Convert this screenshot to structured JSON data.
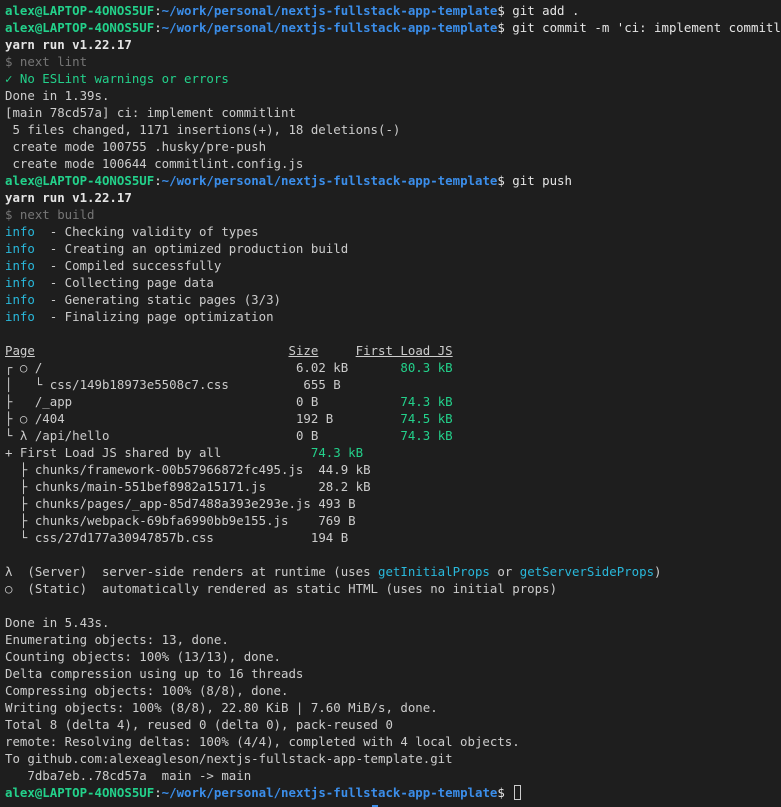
{
  "prompt": {
    "user_host": "alex@LAPTOP-4ONOS5UF",
    "sep": ":",
    "path": "~/work/personal/nextjs-fullstack-app-template",
    "symbol": "$ "
  },
  "lines": [
    {
      "t": "prompt",
      "cmd": "git add ."
    },
    {
      "t": "prompt",
      "cmd": "git commit -m 'ci: implement commitlint'"
    },
    {
      "t": "bold",
      "text": "yarn run v1.22.17"
    },
    {
      "t": "dim",
      "text": "$ next lint"
    },
    {
      "t": "ok",
      "mark": "✓",
      "text": " No ESLint warnings or errors"
    },
    {
      "t": "plain",
      "text": "Done in 1.39s."
    },
    {
      "t": "plain",
      "text": "[main 78cd57a] ci: implement commitlint"
    },
    {
      "t": "plain",
      "text": " 5 files changed, 1171 insertions(+), 18 deletions(-)"
    },
    {
      "t": "plain",
      "text": " create mode 100755 .husky/pre-push"
    },
    {
      "t": "plain",
      "text": " create mode 100644 commitlint.config.js"
    },
    {
      "t": "prompt",
      "cmd": "git push"
    },
    {
      "t": "bold",
      "text": "yarn run v1.22.17"
    },
    {
      "t": "dim",
      "text": "$ next build"
    },
    {
      "t": "info",
      "label": "info",
      "text": "  - Checking validity of types"
    },
    {
      "t": "info",
      "label": "info",
      "text": "  - Creating an optimized production build"
    },
    {
      "t": "info",
      "label": "info",
      "text": "  - Compiled successfully"
    },
    {
      "t": "info",
      "label": "info",
      "text": "  - Collecting page data"
    },
    {
      "t": "info",
      "label": "info",
      "text": "  - Generating static pages (3/3)"
    },
    {
      "t": "info",
      "label": "info",
      "text": "  - Finalizing page optimization"
    },
    {
      "t": "blank"
    },
    {
      "t": "header",
      "page": "Page",
      "g1": "                                  ",
      "size": "Size",
      "g2": "     ",
      "first": "First Load JS"
    },
    {
      "t": "row",
      "prefix": "┌ ○ /",
      "pad1": "                                  ",
      "size": "6.02 kB",
      "pad2": "       ",
      "first": "80.3 kB"
    },
    {
      "t": "row",
      "prefix": "│   └ css/149b18973e5508c7.css",
      "pad1": "          ",
      "size": "655 B",
      "pad2": "",
      "first": ""
    },
    {
      "t": "row",
      "prefix": "├   /_app",
      "pad1": "                              ",
      "size": "0 B",
      "pad2": "           ",
      "first": "74.3 kB"
    },
    {
      "t": "row",
      "prefix": "├ ○ /404",
      "pad1": "                               ",
      "size": "192 B",
      "pad2": "         ",
      "first": "74.5 kB"
    },
    {
      "t": "row",
      "prefix": "└ λ /api/hello",
      "pad1": "                         ",
      "size": "0 B",
      "pad2": "           ",
      "first": "74.3 kB"
    },
    {
      "t": "shared",
      "text": "+ First Load JS shared by all",
      "pad": "            ",
      "first": "74.3 kB"
    },
    {
      "t": "row",
      "prefix": "  ├ chunks/framework-00b57966872fc495.js",
      "pad1": "  ",
      "size": "44.9 kB",
      "pad2": "",
      "first": ""
    },
    {
      "t": "row",
      "prefix": "  ├ chunks/main-551bef8982a15171.js",
      "pad1": "       ",
      "size": "28.2 kB",
      "pad2": "",
      "first": ""
    },
    {
      "t": "row",
      "prefix": "  ├ chunks/pages/_app-85d7488a393e293e.js",
      "pad1": " ",
      "size": "493 B",
      "pad2": "",
      "first": ""
    },
    {
      "t": "row",
      "prefix": "  ├ chunks/webpack-69bfa6990bb9e155.js",
      "pad1": "    ",
      "size": "769 B",
      "pad2": "",
      "first": ""
    },
    {
      "t": "row",
      "prefix": "  └ css/27d177a30947857b.css",
      "pad1": "             ",
      "size": "194 B",
      "pad2": "",
      "first": ""
    },
    {
      "t": "blank"
    },
    {
      "t": "legend1",
      "a": "λ  (Server)  server-side renders at runtime (uses ",
      "c1": "getInitialProps",
      "b": " or ",
      "c2": "getServerSideProps",
      "d": ")"
    },
    {
      "t": "plain",
      "text": "○  (Static)  automatically rendered as static HTML (uses no initial props)"
    },
    {
      "t": "blank"
    },
    {
      "t": "plain",
      "text": "Done in 5.43s."
    },
    {
      "t": "plain",
      "text": "Enumerating objects: 13, done."
    },
    {
      "t": "plain",
      "text": "Counting objects: 100% (13/13), done."
    },
    {
      "t": "plain",
      "text": "Delta compression using up to 16 threads"
    },
    {
      "t": "plain",
      "text": "Compressing objects: 100% (8/8), done."
    },
    {
      "t": "plain",
      "text": "Writing objects: 100% (8/8), 22.80 KiB | 7.60 MiB/s, done."
    },
    {
      "t": "plain",
      "text": "Total 8 (delta 4), reused 0 (delta 0), pack-reused 0"
    },
    {
      "t": "plain",
      "text": "remote: Resolving deltas: 100% (4/4), completed with 4 local objects."
    },
    {
      "t": "plain",
      "text": "To github.com:alexeagleson/nextjs-fullstack-app-template.git"
    },
    {
      "t": "plain",
      "text": "   7dba7eb..78cd57a  main -> main"
    },
    {
      "t": "prompt",
      "cmd": "",
      "cursor": true
    }
  ]
}
